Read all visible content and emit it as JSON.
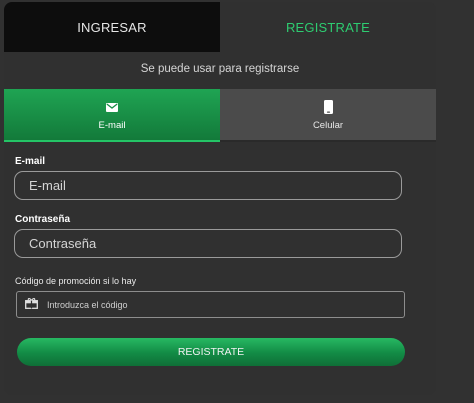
{
  "tabs": {
    "login": "INGRESAR",
    "register": "REGISTRATE"
  },
  "subtitle": "Se puede usar para registrarse",
  "methods": {
    "email": "E-mail",
    "phone": "Celular"
  },
  "form": {
    "email_label": "E-mail",
    "email_placeholder": "E-mail",
    "password_label": "Contraseña",
    "password_placeholder": "Contraseña",
    "promo_label": "Código de promoción si lo hay",
    "promo_placeholder": "Introduzca el código",
    "submit_label": "REGISTRATE"
  },
  "icons": {
    "email_method": "envelope-icon",
    "phone_method": "phone-icon",
    "promo": "gift-icon"
  },
  "colors": {
    "accent": "#2ecc71",
    "active_tab": "#1a8f48",
    "inactive_tab": "#4b4b4b",
    "background": "#303030"
  }
}
